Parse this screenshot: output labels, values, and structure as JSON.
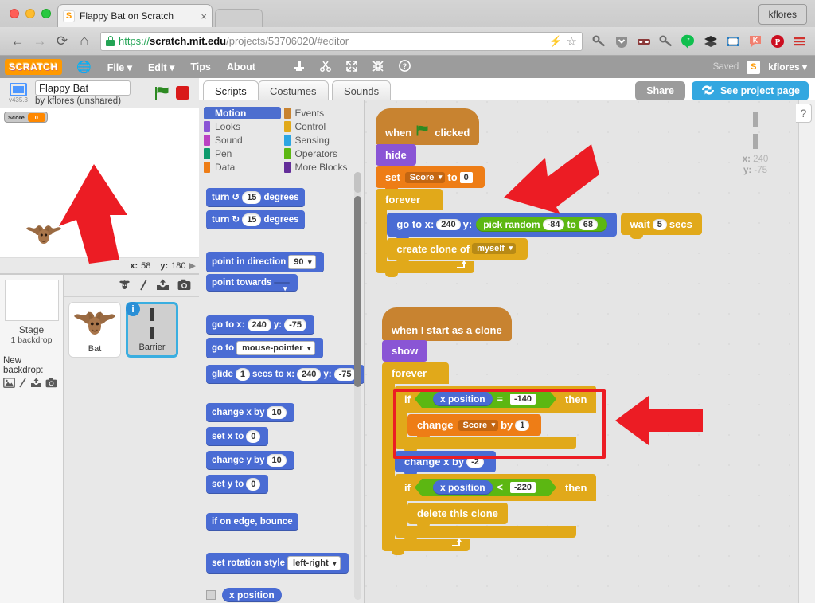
{
  "browser": {
    "tab": {
      "title": "Flappy Bat on Scratch",
      "favicon": "scratch-favicon",
      "close": "×"
    },
    "profile_chip": "kflores",
    "nav": {
      "back": "←",
      "forward": "→",
      "reload": "⟳",
      "home": "⌂"
    },
    "url": {
      "scheme": "https://",
      "host": "scratch.mit.edu",
      "path": "/projects/53706020/#editor"
    },
    "urlbar_icons": {
      "bolt": "⚡",
      "star": "☆",
      "lock": "lock-icon"
    },
    "extensions": [
      {
        "name": "key-icon",
        "glyph": "🗝"
      },
      {
        "name": "shield-down-icon",
        "glyph": "▼"
      },
      {
        "name": "incognito-mask-icon",
        "glyph": "▬"
      },
      {
        "name": "key2-icon",
        "glyph": "🗝"
      },
      {
        "name": "hangouts-icon",
        "glyph": "”"
      },
      {
        "name": "layers-icon",
        "glyph": "≡"
      },
      {
        "name": "screenshot-icon",
        "glyph": "▭"
      },
      {
        "name": "klout-icon",
        "glyph": "K"
      },
      {
        "name": "pinterest-icon",
        "glyph": "P"
      },
      {
        "name": "chrome-menu-icon",
        "glyph": "≡"
      }
    ]
  },
  "scratch_menubar": {
    "logo": "SCRATCH",
    "globe_icon": "🌐",
    "menus": [
      "File ▾",
      "Edit ▾",
      "Tips",
      "About"
    ],
    "tools": [
      {
        "name": "duplicate-tool",
        "glyph": "⚓"
      },
      {
        "name": "cut-tool",
        "glyph": "✂"
      },
      {
        "name": "grow-tool",
        "glyph": "⤢"
      },
      {
        "name": "shrink-tool",
        "glyph": "⤣"
      },
      {
        "name": "help-tool",
        "glyph": "?"
      }
    ],
    "saved_status": "Saved",
    "username": "kflores ▾",
    "avatar_letter": "S"
  },
  "project": {
    "title": "Flappy Bat",
    "title_placeholder": "Project name",
    "author_line": "by kflores (unshared)",
    "stage_version": "v435.3",
    "green_flag": "⚑",
    "stop": "stop-button",
    "share_label": "Share",
    "see_project_label": "See project page",
    "see_project_icon": "↺"
  },
  "stage": {
    "watcher": {
      "label": "Score",
      "value": "0"
    },
    "sprite_glyph": "🦇",
    "readout": {
      "x_label": "x:",
      "x_value": "58",
      "y_label": "y:",
      "y_value": "180",
      "arrow": "▶"
    }
  },
  "sprite_pane": {
    "stage_label": "Stage",
    "stage_sub": "1 backdrop",
    "new_backdrop_label": "New backdrop:",
    "new_backdrop_icons": [
      "🖼",
      "╱",
      "⇧",
      "📷"
    ],
    "toolbar_icons": [
      "🧛",
      "╱",
      "⇧",
      "📷"
    ],
    "sprites": [
      {
        "name": "Bat",
        "glyph": "🦇",
        "selected": false,
        "info_badge": ""
      },
      {
        "name": "Barrier",
        "glyph": "barrier-mark",
        "selected": true,
        "info_badge": "i"
      }
    ]
  },
  "editor_tabs": [
    {
      "label": "Scripts",
      "active": true
    },
    {
      "label": "Costumes",
      "active": false
    },
    {
      "label": "Sounds",
      "active": false
    }
  ],
  "palette": {
    "categories": [
      {
        "label": "Motion",
        "color": "#4d6ecf",
        "active": true
      },
      {
        "label": "Events",
        "color": "#c88330",
        "active": false
      },
      {
        "label": "Looks",
        "color": "#8a55d5",
        "active": false
      },
      {
        "label": "Control",
        "color": "#e1a91a",
        "active": false
      },
      {
        "label": "Sound",
        "color": "#bb42c3",
        "active": false
      },
      {
        "label": "Sensing",
        "color": "#2ca5e2",
        "active": false
      },
      {
        "label": "Pen",
        "color": "#0e9a6c",
        "active": false
      },
      {
        "label": "Operators",
        "color": "#5cb712",
        "active": false
      },
      {
        "label": "Data",
        "color": "#ee7d16",
        "active": false
      },
      {
        "label": "More Blocks",
        "color": "#632d99",
        "active": false
      }
    ],
    "blocks": {
      "turn_ccw": {
        "pre": "turn ↺",
        "val": "15",
        "post": "degrees"
      },
      "turn_cw": {
        "pre": "turn ↻",
        "val": "15",
        "post": "degrees"
      },
      "point_in_direction": {
        "pre": "point in direction",
        "val": "90"
      },
      "point_towards": {
        "pre": "point towards",
        "val": ""
      },
      "go_to_xy": {
        "pre": "go to x:",
        "x": "240",
        "mid": "y:",
        "y": "-75"
      },
      "go_to_target": {
        "pre": "go to",
        "val": "mouse-pointer"
      },
      "glide": {
        "pre": "glide",
        "secs": "1",
        "mid1": "secs to x:",
        "x": "240",
        "mid2": "y:",
        "y": "-75"
      },
      "change_x": {
        "pre": "change x by",
        "val": "10"
      },
      "set_x": {
        "pre": "set x to",
        "val": "0"
      },
      "change_y": {
        "pre": "change y by",
        "val": "10"
      },
      "set_y": {
        "pre": "set y to",
        "val": "0"
      },
      "if_on_edge": {
        "pre": "if on edge, bounce"
      },
      "set_rotation": {
        "pre": "set rotation style",
        "val": "left-right"
      },
      "x_position": {
        "pre": "x position"
      }
    }
  },
  "scripts": {
    "script1": {
      "hat": {
        "pre": "when",
        "flag": "⚑",
        "post": "clicked"
      },
      "hide": "hide",
      "set_var": {
        "pre": "set",
        "var": "Score",
        "mid": "to",
        "val": "0"
      },
      "forever": "forever",
      "go_to": {
        "pre": "go to x:",
        "x": "240",
        "mid": "y:"
      },
      "pick_random": {
        "pre": "pick random",
        "from": "-84",
        "mid": "to",
        "to": "68"
      },
      "wait": {
        "pre": "wait",
        "val": "5",
        "post": "secs"
      },
      "create_clone": {
        "pre": "create clone of",
        "val": "myself"
      },
      "loop_arrow": "↵"
    },
    "script2": {
      "hat": "when I start as a clone",
      "show": "show",
      "forever": "forever",
      "if1": {
        "pre": "if",
        "then": "then",
        "reporter": "x position",
        "op": "=",
        "val": "-140"
      },
      "change_var": {
        "pre": "change",
        "var": "Score",
        "mid": "by",
        "val": "1"
      },
      "change_x": {
        "pre": "change x by",
        "val": "-2"
      },
      "if2": {
        "pre": "if",
        "then": "then",
        "reporter": "x position",
        "op": "<",
        "val": "-220"
      },
      "delete_clone": "delete this clone",
      "loop_arrow": "↵"
    }
  },
  "watermark": {
    "x_label": "x:",
    "x_value": "240",
    "y_label": "y:",
    "y_value": "-75",
    "sprite": "barrier-mark"
  },
  "help_tab": "?",
  "annotations": {
    "arrows": [
      {
        "name": "arrow-to-set-score",
        "direction": "left-down"
      },
      {
        "name": "arrow-to-barrier-sprite",
        "direction": "up"
      },
      {
        "name": "arrow-to-if-score-block",
        "direction": "left"
      }
    ],
    "highlight_box": {
      "name": "if-score-highlight",
      "color": "#ec1c24"
    }
  },
  "colors": {
    "motion": "#4a6cd4",
    "looks": "#8a55d5",
    "data": "#ee7d16",
    "events": "#c88330",
    "control": "#e1a91a",
    "operators": "#5cb712",
    "accent_blue": "#33a7e0",
    "annotation_red": "#ec1c24"
  }
}
